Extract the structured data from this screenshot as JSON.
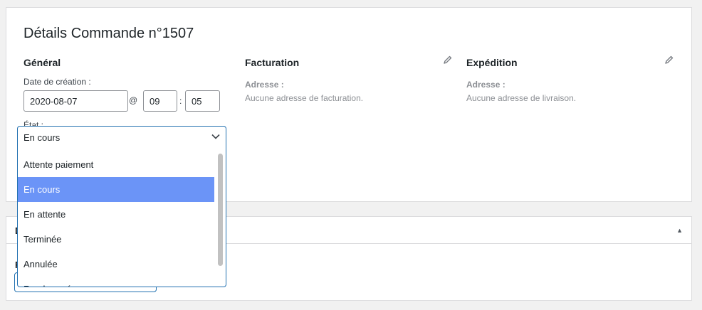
{
  "order": {
    "title": "Détails Commande n°1507"
  },
  "general": {
    "title": "Général",
    "date_label": "Date de création :",
    "date_value": "2020-08-07",
    "at_sep": "@",
    "hour_value": "09",
    "time_sep": ":",
    "minute_value": "05",
    "status_label": "État :",
    "status_selected": "En cours",
    "status_options": [
      {
        "label": "Attente paiement"
      },
      {
        "label": "En cours"
      },
      {
        "label": "En attente"
      },
      {
        "label": "Terminée"
      },
      {
        "label": "Annulée"
      },
      {
        "label": "Remboursée"
      }
    ]
  },
  "billing": {
    "title": "Facturation",
    "address_label": "Adresse :",
    "address_value": "Aucune adresse de facturation."
  },
  "shipping": {
    "title": "Expédition",
    "address_label": "Adresse :",
    "address_value": "Aucune adresse de livraison."
  },
  "second_panel": {
    "title": "D",
    "field_label": "Fa"
  },
  "colors": {
    "accent": "#2271b1",
    "highlight": "#6b94f7",
    "muted": "#8c8f94"
  }
}
